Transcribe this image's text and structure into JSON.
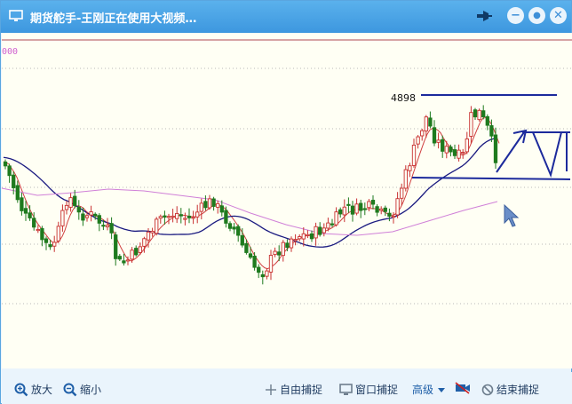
{
  "window": {
    "title": "期货舵手-王刚正在使用大视频…",
    "buttons": {
      "minimize": "−",
      "restore": "●",
      "close": "✕"
    }
  },
  "chart": {
    "axis_label": "000",
    "peak_label": "4898"
  },
  "toolbar": {
    "zoom_in": "放大",
    "zoom_out": "缩小",
    "free_capture": "自由捕捉",
    "window_capture": "窗口捕捉",
    "advanced": "高级",
    "end_capture": "结束捕捉"
  },
  "colors": {
    "titlebar": "#4aa3e6",
    "candle_up": "#c83030",
    "candle_down": "#1e7a1e",
    "ma_short": "#d04040",
    "ma_long": "#1a1a80",
    "ma_longer": "#d080d8",
    "annotation": "#1c2a9c"
  }
}
